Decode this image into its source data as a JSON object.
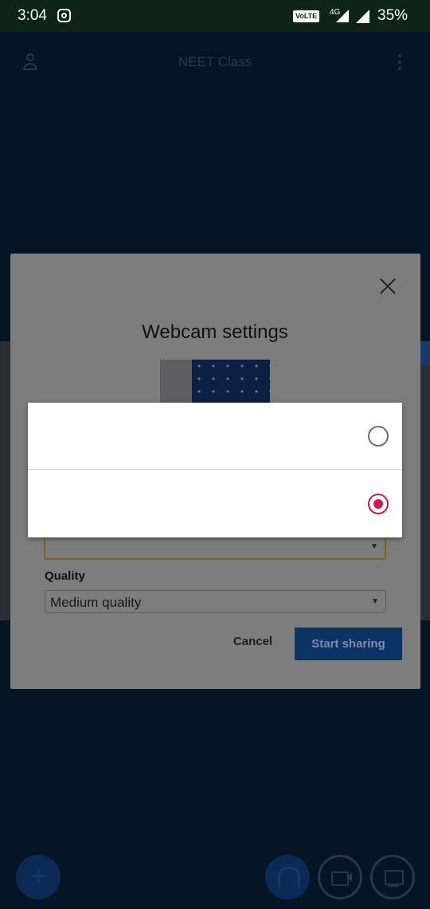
{
  "status_bar": {
    "time": "3:04",
    "network_badge": "VoLTE",
    "network_type": "4G",
    "battery": "35%"
  },
  "app": {
    "title": "NEET Class"
  },
  "dialog": {
    "title": "Webcam settings",
    "device_value": "",
    "quality_label": "Quality",
    "quality_value": "Medium quality",
    "cancel_label": "Cancel",
    "start_label": "Start sharing"
  },
  "picker": {
    "options": [
      {
        "label": "",
        "selected": false
      },
      {
        "label": "",
        "selected": true
      }
    ],
    "accent_color": "#cc1b56"
  },
  "colors": {
    "background": "#061526",
    "dialog_primary": "#0b3366"
  }
}
